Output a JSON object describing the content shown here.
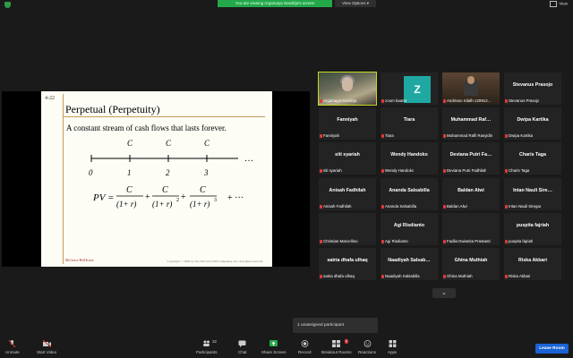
{
  "top_bar": {
    "banner_text": "You are viewing Argamaya Soedirja's screen",
    "view_options_label": "View Options",
    "view_label": "View"
  },
  "slide": {
    "number": "4-22",
    "title": "Perpetual (Perpetuity)",
    "subtitle": "A constant stream of cash flows that lasts forever.",
    "timeline_ticks": [
      "0",
      "1",
      "2",
      "3"
    ],
    "cash_flow_label": "C",
    "ellipsis": "…",
    "formula_lhs": "PV =",
    "formula_numerator": "C",
    "formula_denominator_base": "(1+ r)",
    "formula_exponents": [
      "",
      "2",
      "3"
    ],
    "formula_tail": "+ ···",
    "footer_left": "McGraw-Hill/Irwin",
    "footer_right": "Copyright © 2006 by The McGraw-Hill Companies, Inc. All rights reserved."
  },
  "participants": [
    {
      "big": "",
      "small": "Argamaya Soedirja",
      "kind": "photo"
    },
    {
      "big": "",
      "small": "zoom baa04",
      "kind": "z"
    },
    {
      "big": "",
      "small": "Andriano Silalh-120912…",
      "kind": "photo2"
    },
    {
      "big": "Stevanus Prasojo",
      "small": "Stevanus Prasojo",
      "kind": "text"
    },
    {
      "big": "Fanniyah",
      "small": "Fanniyah",
      "kind": "text"
    },
    {
      "big": "Tiara",
      "small": "Tiara",
      "kind": "text"
    },
    {
      "big": "Muhammad Raf…",
      "small": "Muhammad Rafli Rasyidin",
      "kind": "text"
    },
    {
      "big": "Dwipa Kartika",
      "small": "Dwipa Kartika",
      "kind": "text"
    },
    {
      "big": "siti syariah",
      "small": "siti syariah",
      "kind": "text"
    },
    {
      "big": "Wendy Handoko",
      "small": "Wendy Handoko",
      "kind": "text"
    },
    {
      "big": "Deviana Putri Fa…",
      "small": "Deviana Putri Fadhilah",
      "kind": "text"
    },
    {
      "big": "Charis Taga",
      "small": "Charis Taga",
      "kind": "text"
    },
    {
      "big": "Anisah Fadhilah",
      "small": "Anisah Fadhilah",
      "kind": "text"
    },
    {
      "big": "Ananda Salsabilla",
      "small": "Ananda Salsabilla",
      "kind": "text"
    },
    {
      "big": "Baldan Alwi",
      "small": "Baldan Alwi",
      "kind": "text"
    },
    {
      "big": "Intan Nauli Sire…",
      "small": "Intan Nauli Siregar",
      "kind": "text"
    },
    {
      "big": "",
      "small": "Christian Marcellino",
      "kind": "text"
    },
    {
      "big": "Agi Risdianto",
      "small": "Agi Risdianto",
      "kind": "text"
    },
    {
      "big": "",
      "small": "Fadila Dwianita Prastanti",
      "kind": "text"
    },
    {
      "big": "puspita fajriah",
      "small": "puspita fajriah",
      "kind": "text"
    },
    {
      "big": "satria dhafa ulhaq",
      "small": "satria dhafa ulhaq",
      "kind": "text"
    },
    {
      "big": "Naadiyah Salsab…",
      "small": "Naadiyah Salsabilla",
      "kind": "text"
    },
    {
      "big": "Ghina Muthiah",
      "small": "Ghina Muthiah",
      "kind": "text"
    },
    {
      "big": "Riska Akbari",
      "small": "Riska Akbari",
      "kind": "text"
    }
  ],
  "more_chevron": "⌄",
  "toast": "1 unassigned participant",
  "toolbar": {
    "unmute": "Unmute",
    "start_video": "Start Video",
    "participants": "Participants",
    "participants_count": "32",
    "chat": "Chat",
    "share_screen": "Share Screen",
    "record": "Record",
    "breakout_rooms": "Breakout Rooms",
    "breakout_badge": "1",
    "reactions": "Reactions",
    "apps": "Apps",
    "leave": "Leave Room"
  },
  "colors": {
    "banner_green": "#23a94a",
    "active_speaker_outline": "#c8d624",
    "muted_red": "#e23a3a",
    "leave_blue": "#1a63d6",
    "share_green": "#23a94a"
  }
}
